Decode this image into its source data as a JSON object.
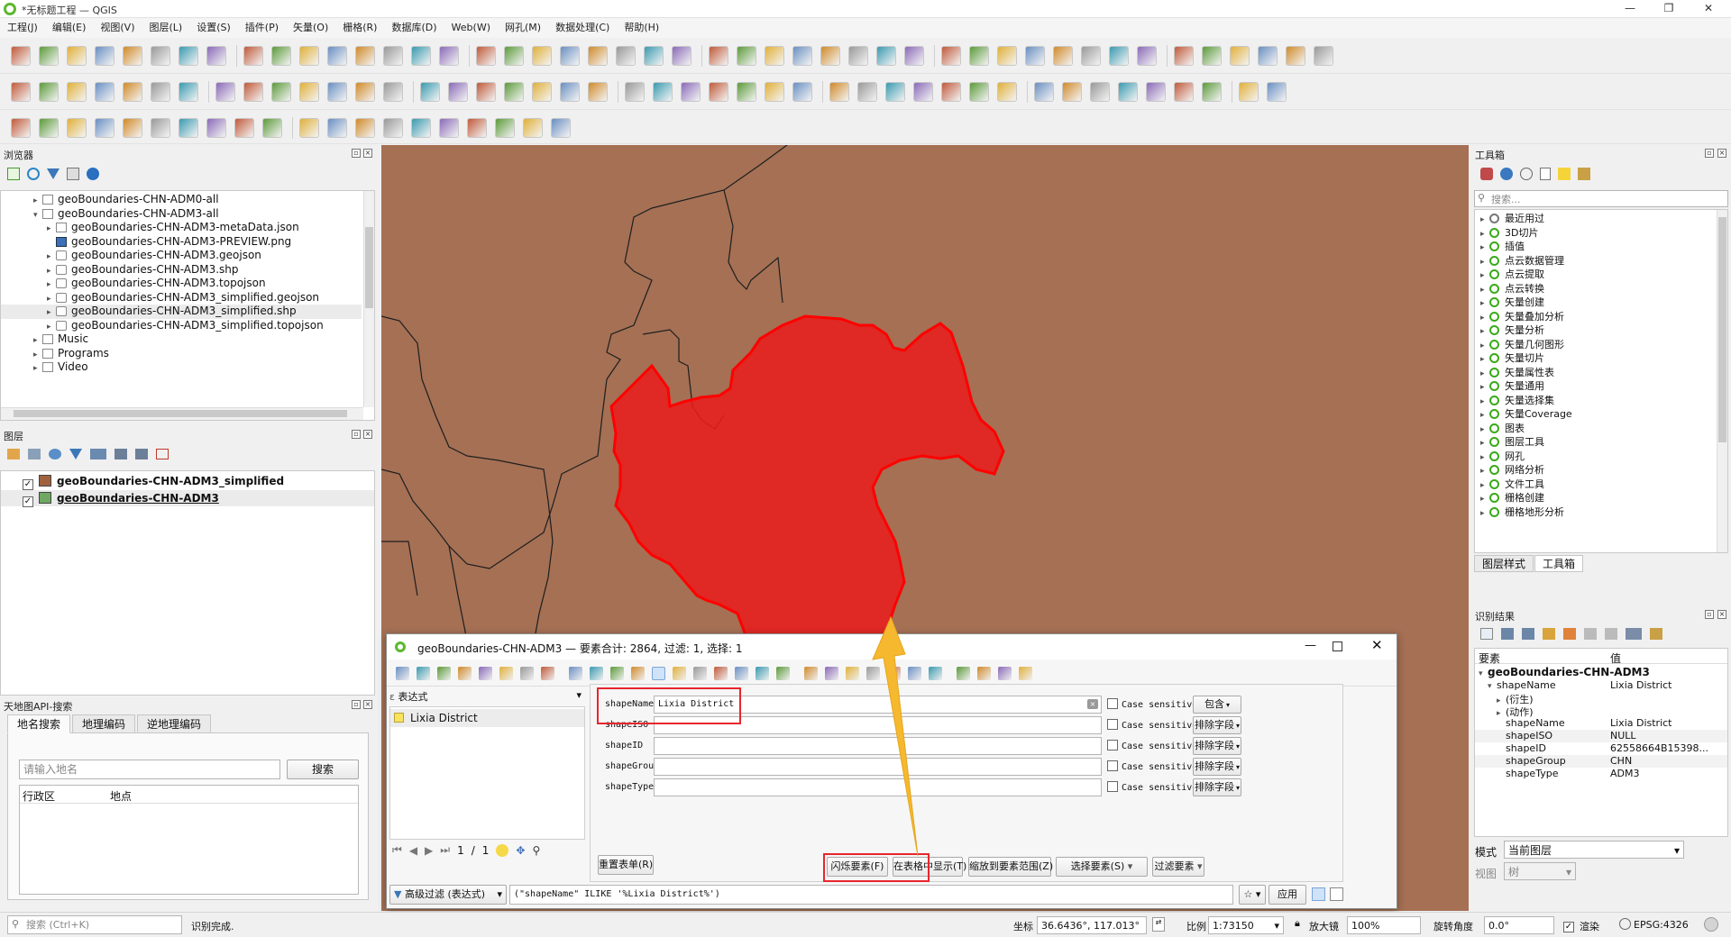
{
  "window": {
    "title": "*无标题工程 — QGIS",
    "minimize": "—",
    "maximize": "❐",
    "close": "✕"
  },
  "menu": [
    "工程(J)",
    "编辑(E)",
    "视图(V)",
    "图层(L)",
    "设置(S)",
    "插件(P)",
    "矢量(O)",
    "栅格(R)",
    "数据库(D)",
    "Web(W)",
    "网孔(M)",
    "数据处理(C)",
    "帮助(H)"
  ],
  "browser": {
    "title": "浏览器",
    "items": [
      {
        "label": "geoBoundaries-CHN-ADM0-all",
        "kind": "folder",
        "level": 0,
        "arrow": "▸"
      },
      {
        "label": "geoBoundaries-CHN-ADM3-all",
        "kind": "folder",
        "level": 0,
        "arrow": "▾"
      },
      {
        "label": "geoBoundaries-CHN-ADM3-metaData.json",
        "kind": "file",
        "level": 1,
        "arrow": "▸"
      },
      {
        "label": "geoBoundaries-CHN-ADM3-PREVIEW.png",
        "kind": "raster",
        "level": 1,
        "arrow": ""
      },
      {
        "label": "geoBoundaries-CHN-ADM3.geojson",
        "kind": "vector",
        "level": 1,
        "arrow": "▸"
      },
      {
        "label": "geoBoundaries-CHN-ADM3.shp",
        "kind": "vector",
        "level": 1,
        "arrow": "▸"
      },
      {
        "label": "geoBoundaries-CHN-ADM3.topojson",
        "kind": "vector",
        "level": 1,
        "arrow": "▸"
      },
      {
        "label": "geoBoundaries-CHN-ADM3_simplified.geojson",
        "kind": "vector",
        "level": 1,
        "arrow": "▸"
      },
      {
        "label": "geoBoundaries-CHN-ADM3_simplified.shp",
        "kind": "vector",
        "level": 1,
        "arrow": "▸",
        "selected": true
      },
      {
        "label": "geoBoundaries-CHN-ADM3_simplified.topojson",
        "kind": "vector",
        "level": 1,
        "arrow": "▸"
      },
      {
        "label": "Music",
        "kind": "folder",
        "level": 0,
        "arrow": "▸"
      },
      {
        "label": "Programs",
        "kind": "folder",
        "level": 0,
        "arrow": "▸"
      },
      {
        "label": "Video",
        "kind": "folder",
        "level": 0,
        "arrow": "▸"
      }
    ]
  },
  "layers": {
    "title": "图层",
    "items": [
      {
        "label": "geoBoundaries-CHN-ADM3_simplified",
        "checked": "✓",
        "color": "#a0623e",
        "underline": false
      },
      {
        "label": "geoBoundaries-CHN-ADM3",
        "checked": "✓",
        "color": "#6fa863",
        "underline": true
      }
    ]
  },
  "tianditu": {
    "title": "天地图API-搜索",
    "tabs": [
      "地名搜索",
      "地理编码",
      "逆地理编码"
    ],
    "placeholder": "请输入地名",
    "search_btn": "搜索",
    "col_region": "行政区",
    "col_place": "地点"
  },
  "attr_table": {
    "title": "geoBoundaries-CHN-ADM3 — 要素合计: 2864, 过滤: 1, 选择: 1",
    "expr_label": "表达式",
    "feature": "Lixia District",
    "fields": [
      {
        "name": "shapeName",
        "value": "Lixia District",
        "mode": "包含"
      },
      {
        "name": "shapeISO",
        "value": "",
        "mode": "排除字段"
      },
      {
        "name": "shapeID",
        "value": "",
        "mode": "排除字段"
      },
      {
        "name": "shapeGroup",
        "value": "",
        "mode": "排除字段"
      },
      {
        "name": "shapeType",
        "value": "",
        "mode": "排除字段"
      }
    ],
    "case_label": "Case sensitive",
    "page": "1",
    "page_sep": "/",
    "page_total": "1",
    "reset_btn": "重置表单(R)",
    "flash_btn": "闪烁要素(F)",
    "show_btn": "在表格中显示(T)",
    "zoom_btn": "缩放到要素范围(Z)",
    "select_btn": "选择要素(S)",
    "filter_btn": "过滤要素",
    "adv_filter": "高级过滤 (表达式)",
    "filter_expr": "(\"shapeName\" ILIKE '%Lixia District%')",
    "apply_btn": "应用"
  },
  "toolbox": {
    "title": "工具箱",
    "placeholder": "搜索...",
    "items": [
      "最近用过",
      "3D切片",
      "插值",
      "点云数据管理",
      "点云提取",
      "点云转换",
      "矢量创建",
      "矢量叠加分析",
      "矢量分析",
      "矢量几何图形",
      "矢量切片",
      "矢量属性表",
      "矢量通用",
      "矢量选择集",
      "矢量Coverage",
      "图表",
      "图层工具",
      "网孔",
      "网络分析",
      "文件工具",
      "栅格创建",
      "栅格地形分析"
    ],
    "tabs": [
      "图层样式",
      "工具箱"
    ]
  },
  "identify": {
    "title": "识别结果",
    "col_feature": "要素",
    "col_value": "值",
    "layer": "geoBoundaries-CHN-ADM3",
    "rows": [
      {
        "k": "shapeName",
        "v": "Lixia District",
        "indent": 1,
        "arrow": "▾"
      },
      {
        "k": "(衍生)",
        "v": "",
        "indent": 2,
        "arrow": "▸"
      },
      {
        "k": "(动作)",
        "v": "",
        "indent": 2,
        "arrow": "▸"
      },
      {
        "k": "shapeName",
        "v": "Lixia District",
        "indent": 2,
        "arrow": ""
      },
      {
        "k": "shapeISO",
        "v": "NULL",
        "indent": 2,
        "arrow": ""
      },
      {
        "k": "shapeID",
        "v": "62558664B15398...",
        "indent": 2,
        "arrow": ""
      },
      {
        "k": "shapeGroup",
        "v": "CHN",
        "indent": 2,
        "arrow": ""
      },
      {
        "k": "shapeType",
        "v": "ADM3",
        "indent": 2,
        "arrow": ""
      }
    ],
    "mode_label": "模式",
    "mode_value": "当前图层",
    "view_label": "视图",
    "view_value": "树"
  },
  "statusbar": {
    "search_placeholder": "搜索 (Ctrl+K)",
    "message": "识别完成.",
    "coord_label": "坐标",
    "coord_value": "36.6436°, 117.013°",
    "scale_label": "比例",
    "scale_value": "1:73150",
    "mag_label": "放大镜",
    "mag_value": "100%",
    "rot_label": "旋转角度",
    "rot_value": "0.0°",
    "render_label": "渲染",
    "epsg": "EPSG:4326"
  },
  "colors": {
    "map_bg": "#a57054",
    "highlight": "#e8262d",
    "accent": "#5cb82e"
  }
}
